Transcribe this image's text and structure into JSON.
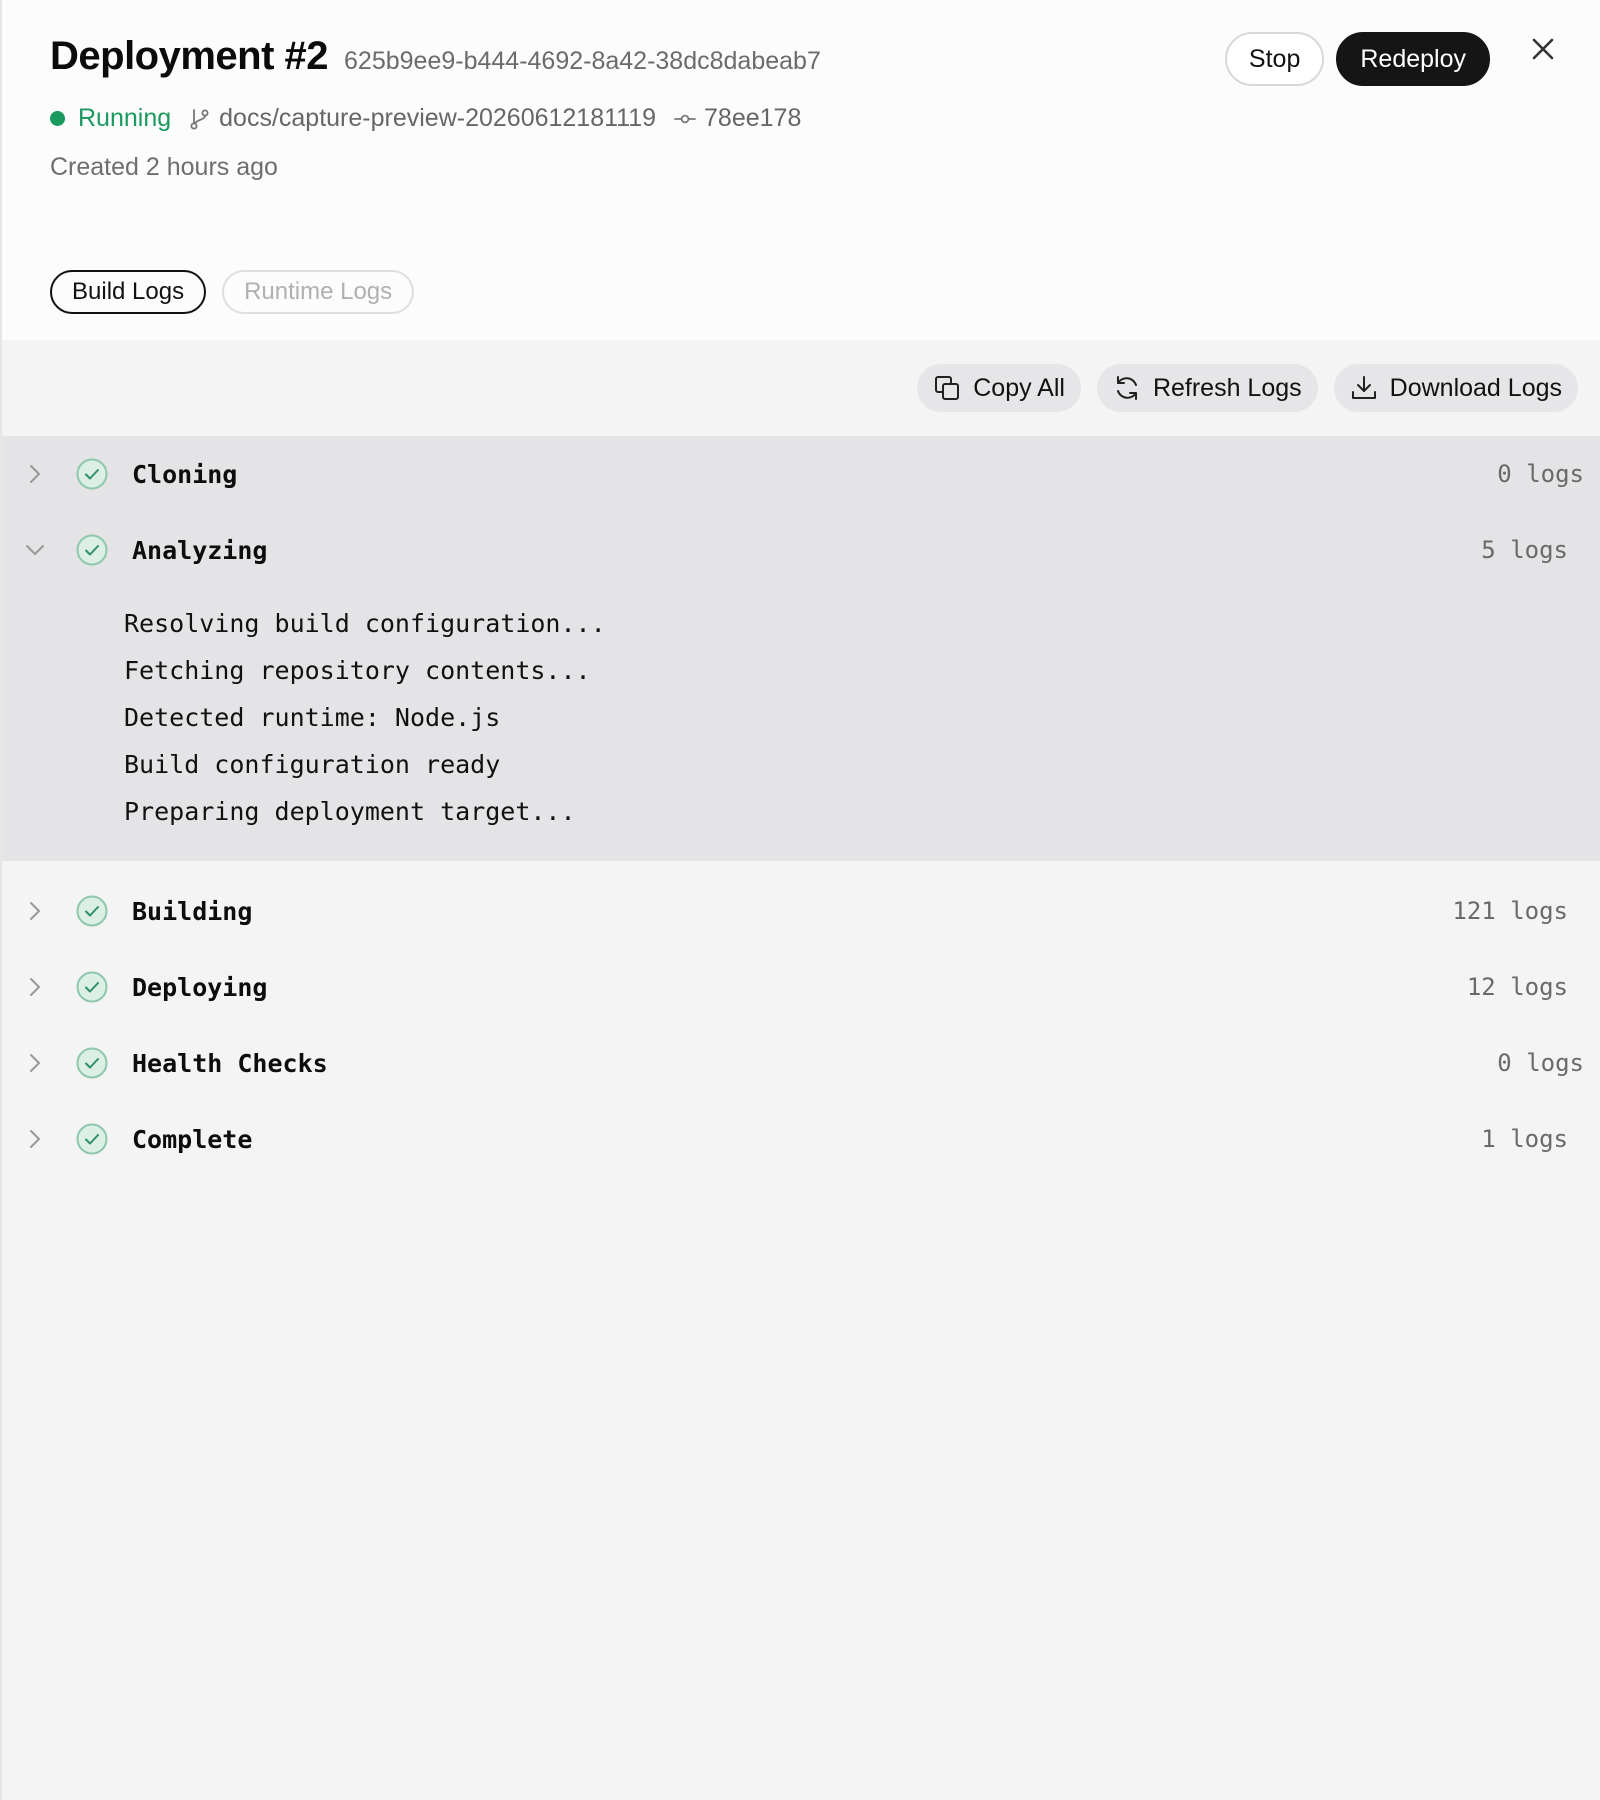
{
  "header": {
    "title": "Deployment #2",
    "deployment_id": "625b9ee9-b444-4692-8a42-38dc8dabeab7",
    "status": "Running",
    "branch": "docs/capture-preview-20260612181119",
    "commit": "78ee178",
    "created": "Created 2 hours ago",
    "stop_label": "Stop",
    "redeploy_label": "Redeploy"
  },
  "tabs": {
    "build": "Build Logs",
    "runtime": "Runtime Logs"
  },
  "toolbar": {
    "copy_all": "Copy All",
    "refresh": "Refresh Logs",
    "download": "Download Logs"
  },
  "steps": [
    {
      "name": "Cloning",
      "count": "0 logs",
      "expanded": false
    },
    {
      "name": "Analyzing",
      "count": "5 logs",
      "expanded": true,
      "lines": [
        "Resolving build configuration...",
        "Fetching repository contents...",
        "Detected runtime: Node.js",
        "Build configuration ready",
        "Preparing deployment target..."
      ]
    },
    {
      "name": "Building",
      "count": "121 logs",
      "expanded": false
    },
    {
      "name": "Deploying",
      "count": "12 logs",
      "expanded": false
    },
    {
      "name": "Health Checks",
      "count": "0 logs",
      "expanded": false
    },
    {
      "name": "Complete",
      "count": "1 logs",
      "expanded": false
    }
  ],
  "colors": {
    "status_green": "#1a9a5e",
    "check_green": "#2f8f6a",
    "dark_button": "#151515",
    "log_background": "#f4f4f5",
    "expanded_background": "#e4e4e7"
  },
  "icons": {
    "close": "close-icon",
    "branch": "git-branch-icon",
    "commit": "git-commit-icon",
    "copy": "copy-icon",
    "refresh": "refresh-icon",
    "download": "download-icon",
    "chevron_right": "chevron-right-icon",
    "chevron_down": "chevron-down-icon",
    "check": "check-circle-icon"
  }
}
